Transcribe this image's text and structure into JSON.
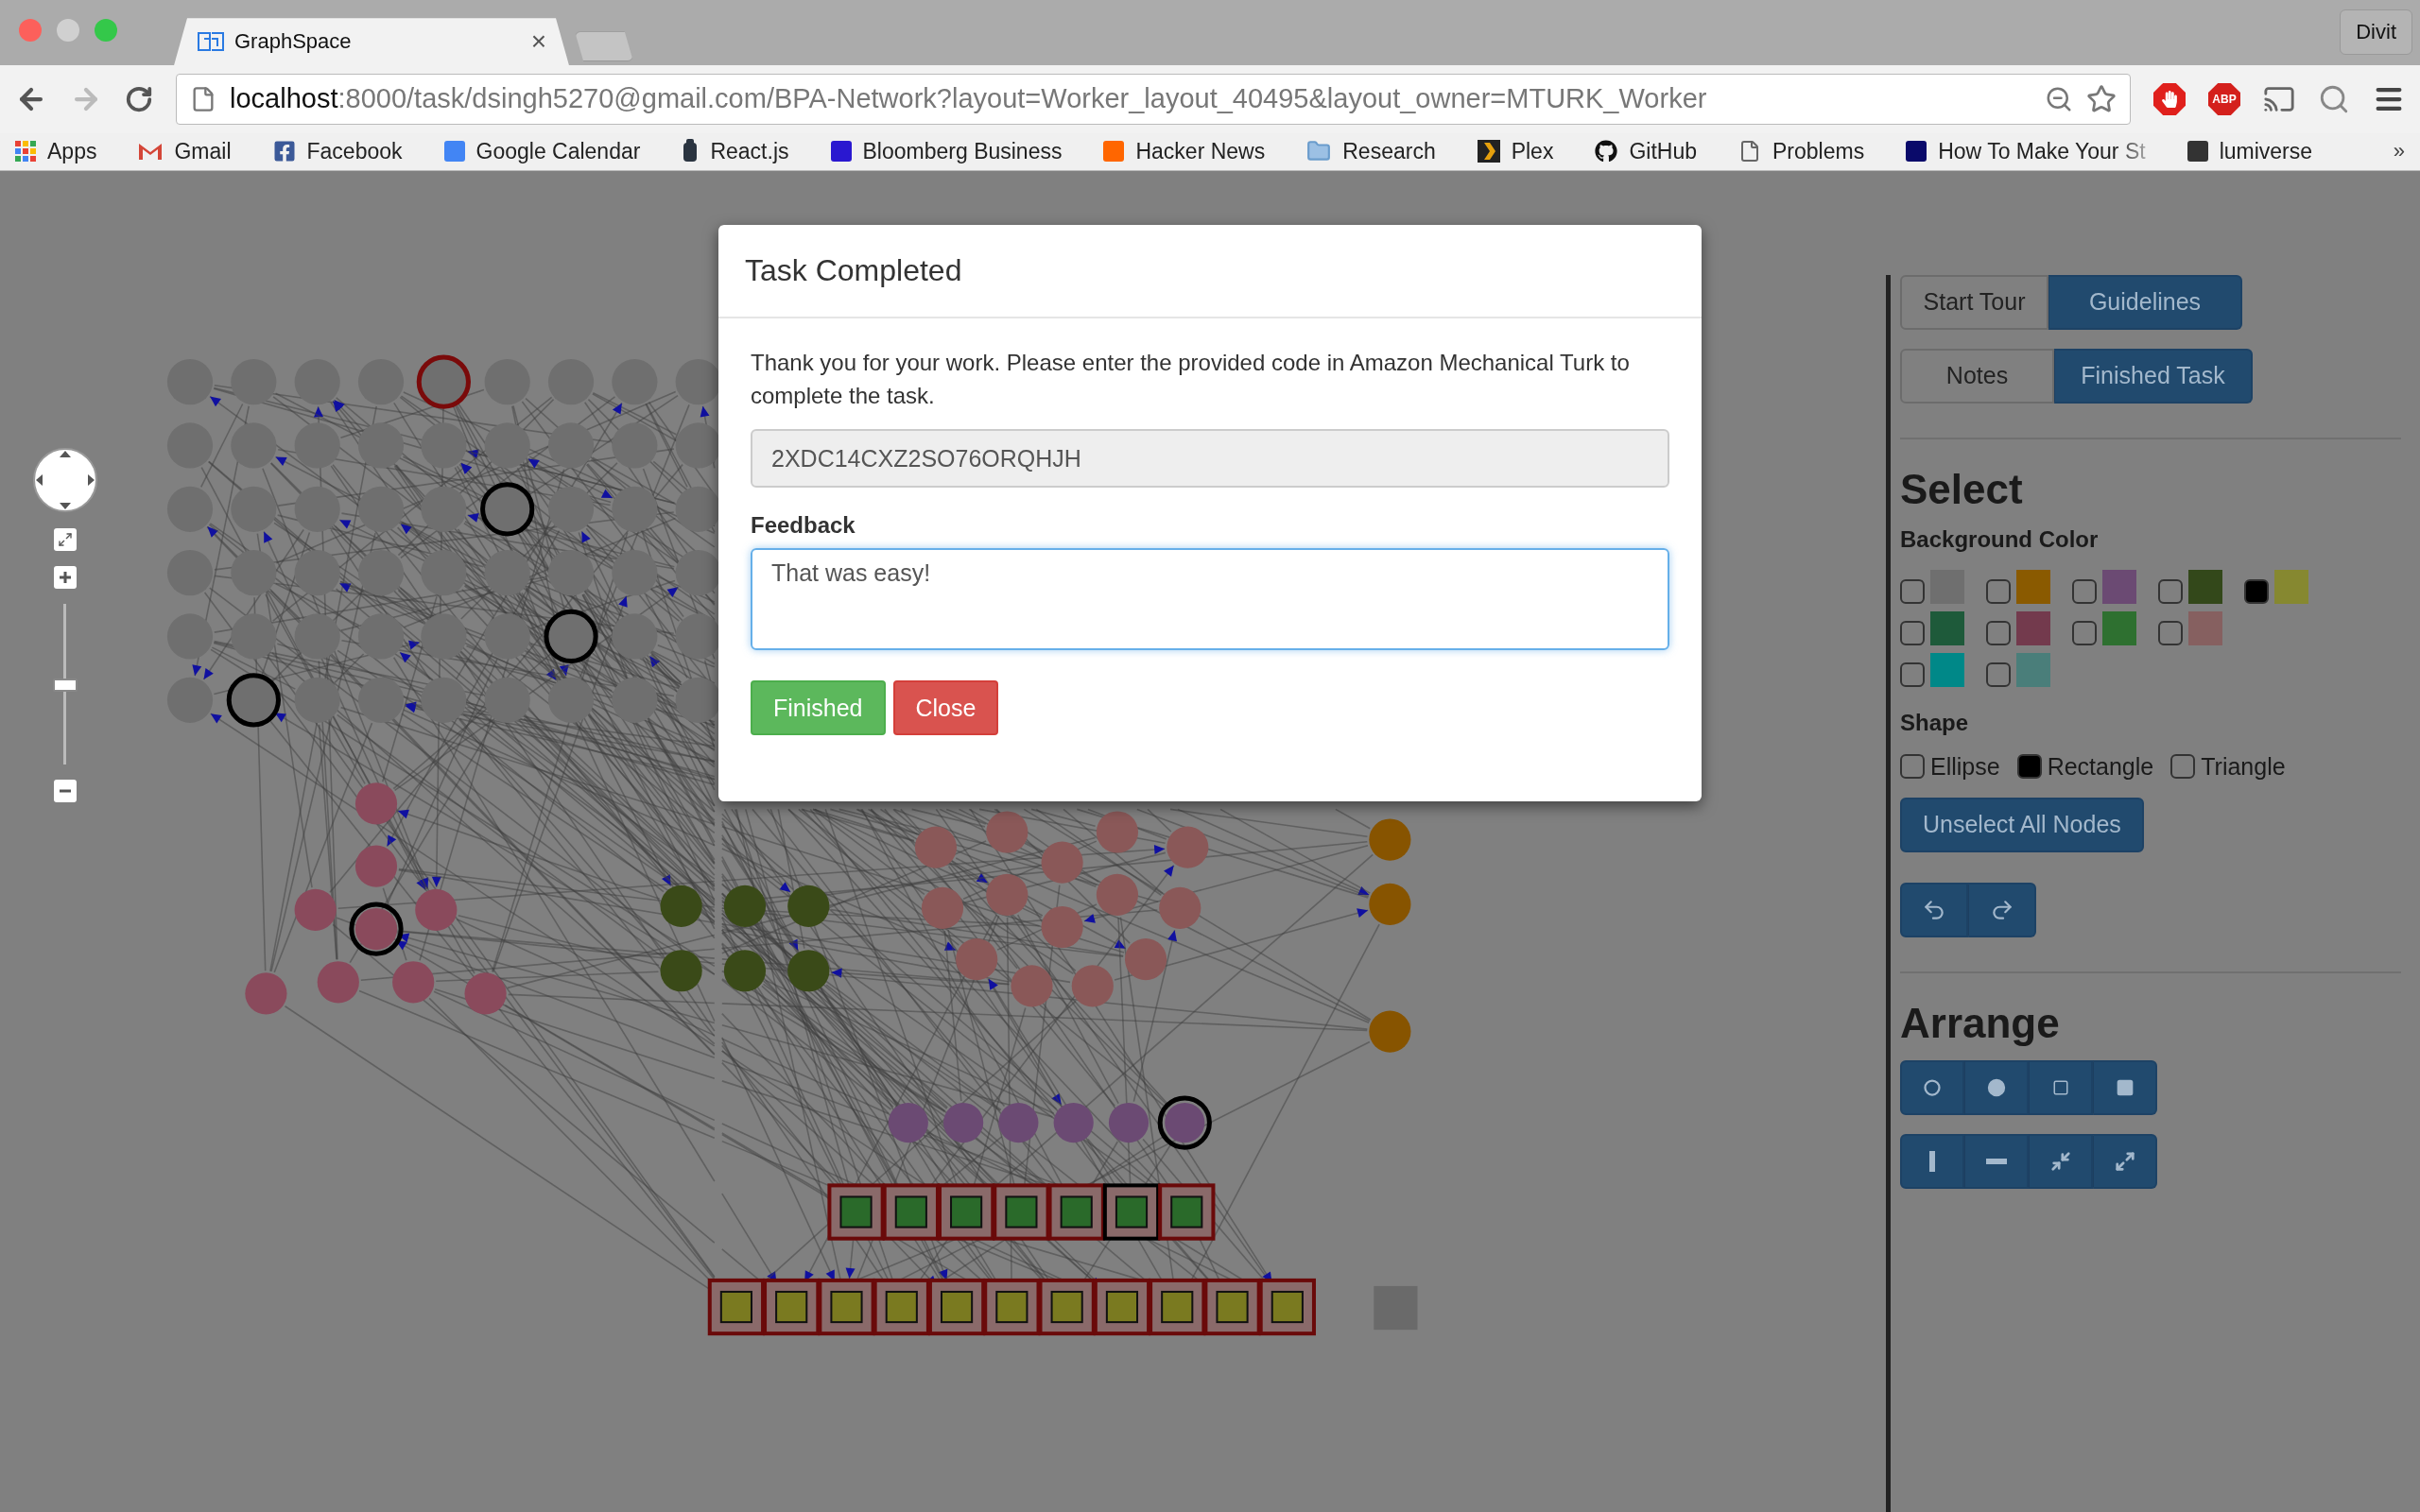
{
  "browser": {
    "tabs": [
      {
        "title": "GraphSpace",
        "close": "×",
        "selected": true
      }
    ],
    "profile": "Divit",
    "address": {
      "host": "localhost",
      "rest": ":8000/task/dsingh5270@gmail.com/BPA-Network?layout=Worker_layout_40495&layout_owner=MTURK_Worker"
    },
    "adblock_label": "ABP",
    "bookmarks": [
      {
        "label": "Apps"
      },
      {
        "label": "Gmail"
      },
      {
        "label": "Facebook"
      },
      {
        "label": "Google Calendar"
      },
      {
        "label": "React.js"
      },
      {
        "label": "Bloomberg Business"
      },
      {
        "label": "Hacker News"
      },
      {
        "label": "Research"
      },
      {
        "label": "Plex"
      },
      {
        "label": "GitHub"
      },
      {
        "label": "Problems"
      },
      {
        "label": "How To Make Your St"
      },
      {
        "label": "lumiverse"
      }
    ],
    "bookmarks_overflow": "»"
  },
  "zoom_control": {
    "level": 0.5
  },
  "modal": {
    "title": "Task Completed",
    "message": "Thank you for your work. Please enter the provided code in Amazon Mechanical Turk to complete the task.",
    "code": "2XDC14CXZ2SO76ORQHJH",
    "feedback_label": "Feedback",
    "feedback_value": "That was easy!",
    "buttons": [
      {
        "label": "Finished",
        "kind": "success"
      },
      {
        "label": "Close",
        "kind": "danger"
      }
    ]
  },
  "panel": {
    "tour_buttons": [
      {
        "label": "Start Tour",
        "kind": "default"
      },
      {
        "label": "Guidelines",
        "kind": "primary"
      }
    ],
    "task_buttons": [
      {
        "label": "Notes",
        "kind": "default"
      },
      {
        "label": "Finished Task",
        "kind": "primary"
      }
    ],
    "select": {
      "title": "Select",
      "background_label": "Background Color",
      "swatch_rows": [
        [
          {
            "color": "#6f6f6f",
            "checked": false
          },
          {
            "color": "#8a5a00",
            "checked": false
          },
          {
            "color": "#6b4a73",
            "checked": false
          },
          {
            "color": "#33481a",
            "checked": false
          },
          {
            "color": "#868830",
            "checked": true
          }
        ],
        [
          {
            "color": "#1e5a3a",
            "checked": false
          },
          {
            "color": "#733a4d",
            "checked": false
          },
          {
            "color": "#2e7030",
            "checked": false
          },
          {
            "color": "#866060",
            "checked": false
          }
        ],
        [
          {
            "color": "#008888",
            "checked": false
          },
          {
            "color": "#4a7e7a",
            "checked": false
          }
        ]
      ],
      "shape_label": "Shape",
      "shapes": [
        {
          "label": "Ellipse",
          "checked": false
        },
        {
          "label": "Rectangle",
          "checked": true
        },
        {
          "label": "Triangle",
          "checked": false
        }
      ],
      "unselect_button": "Unselect All Nodes"
    },
    "arrange": {
      "title": "Arrange"
    }
  }
}
